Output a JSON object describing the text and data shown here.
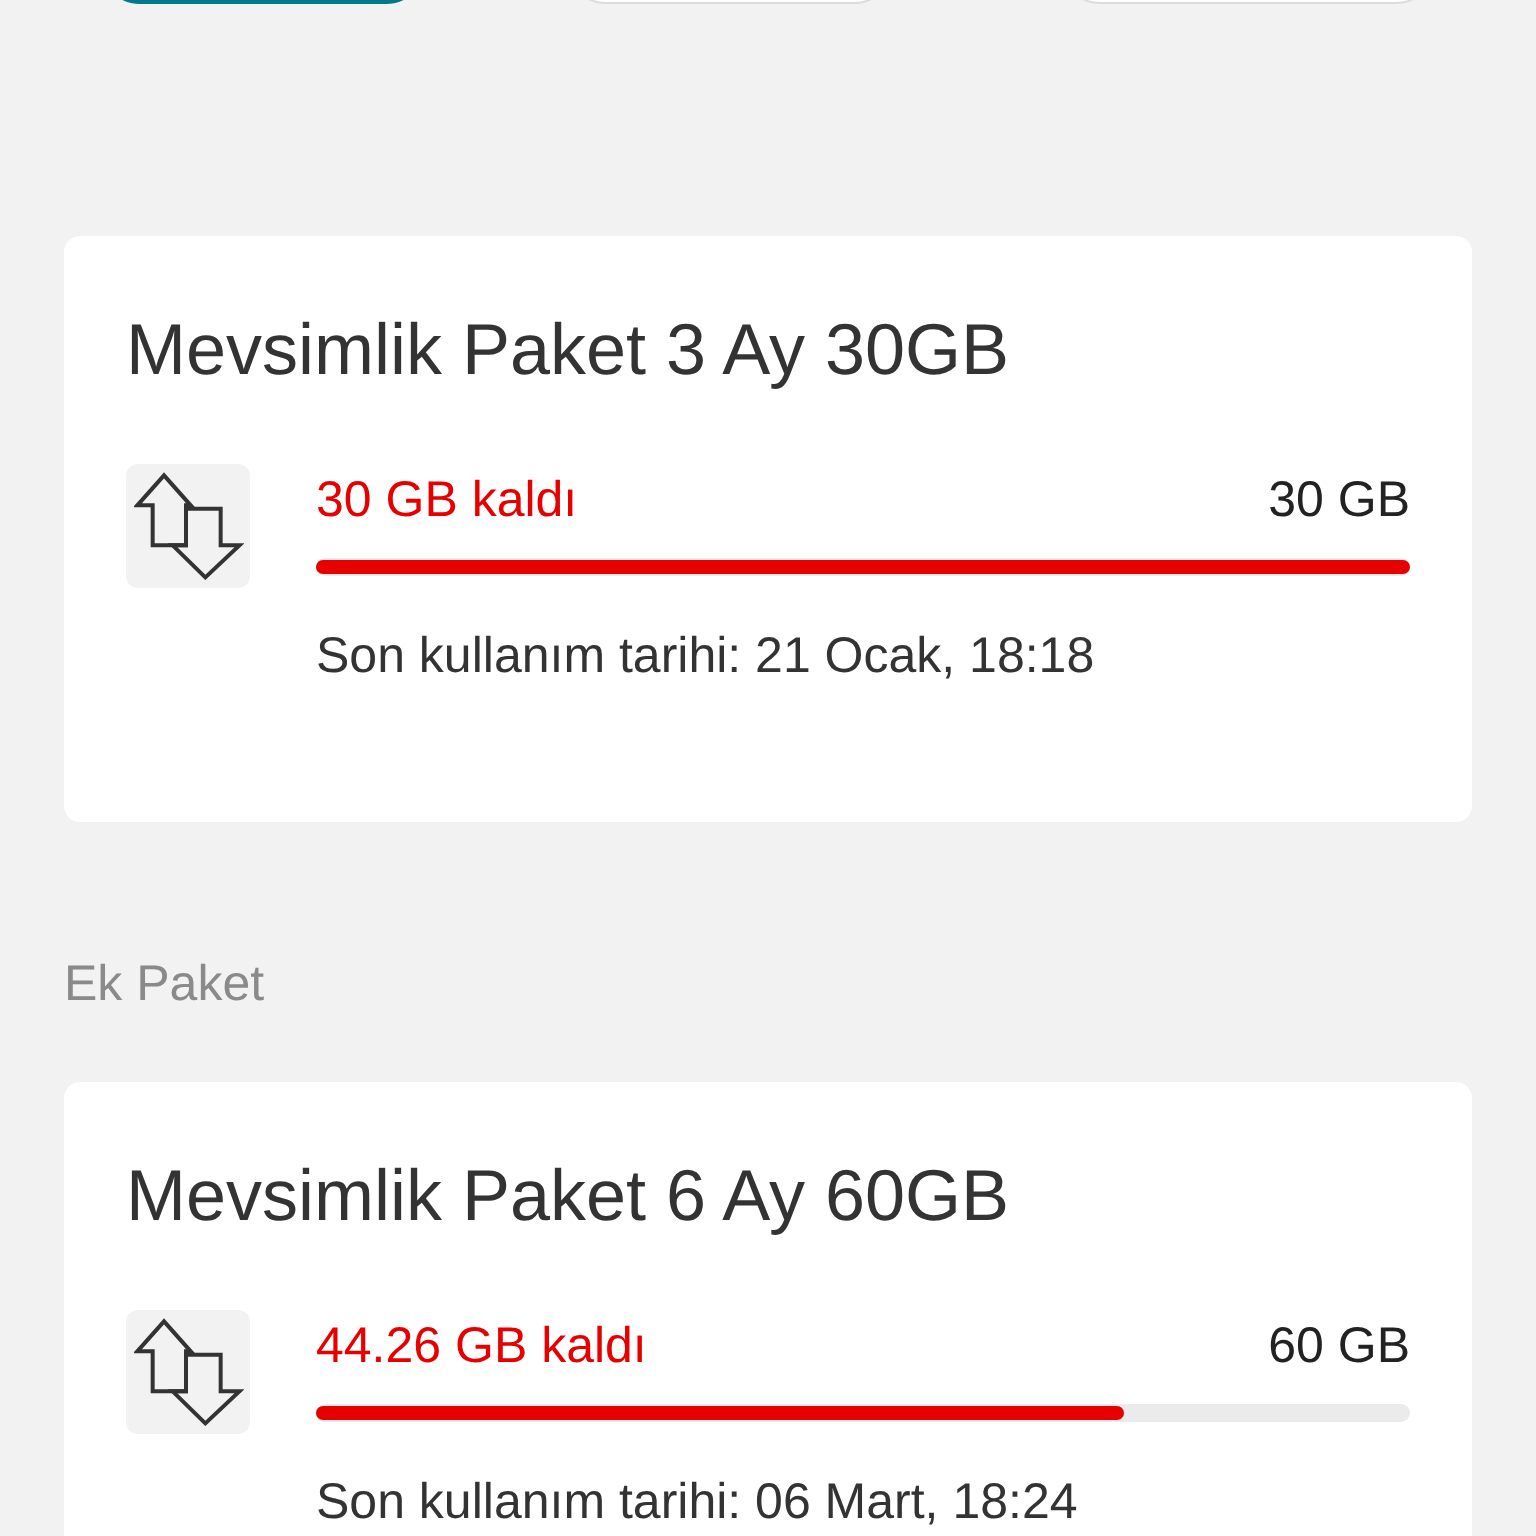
{
  "filter_buttons": [
    {
      "selected": true
    },
    {
      "selected": false
    },
    {
      "selected": false
    }
  ],
  "packages": [
    {
      "title": "Mevsimlik Paket 3 Ay 30GB",
      "remaining": "30 GB kaldı",
      "total": "30 GB",
      "level": 1,
      "expiry": "Son kullanım tarihi: 21 Ocak, 18:18"
    },
    {
      "section_label": "Ek Paket",
      "title": "Mevsimlik Paket 6 Ay 60GB",
      "remaining": "44.26 GB kaldı",
      "total": "60 GB",
      "level": 0.7377,
      "expiry": "Son kullanım tarihi: 06 Mart, 18:24"
    }
  ]
}
